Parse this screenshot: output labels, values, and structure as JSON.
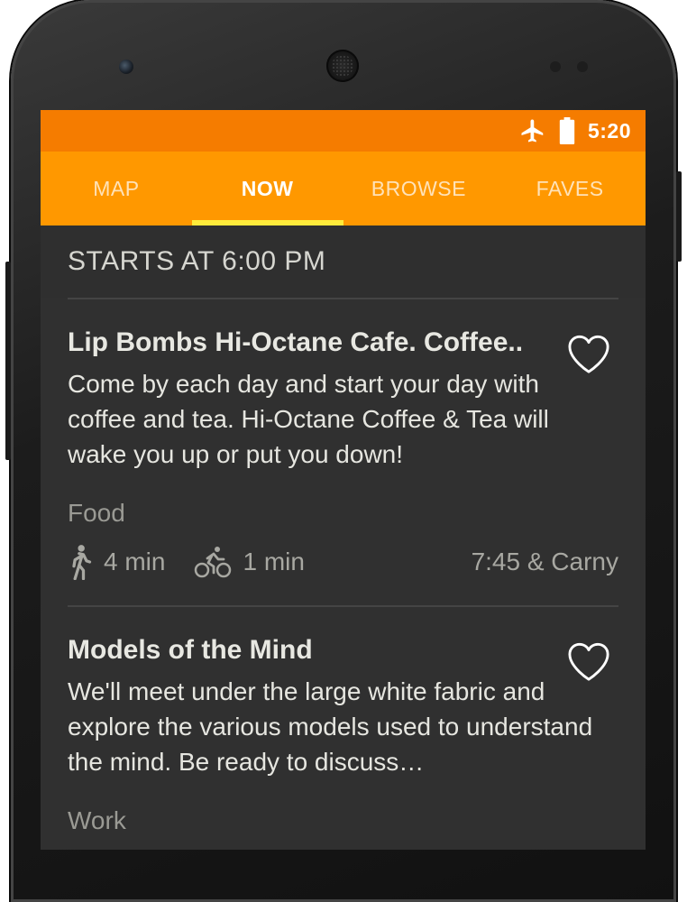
{
  "status_bar": {
    "airplane_icon": "airplane-icon",
    "battery_icon": "battery-icon",
    "time": "5:20",
    "color": "#f57c00"
  },
  "tabs": [
    {
      "label": "MAP",
      "active": false
    },
    {
      "label": "NOW",
      "active": true
    },
    {
      "label": "BROWSE",
      "active": false
    },
    {
      "label": "FAVES",
      "active": false
    }
  ],
  "tab_bar_color": "#ff9800",
  "tab_indicator_color": "#ffeb3b",
  "section": {
    "header": "STARTS AT 6:00 PM"
  },
  "events": [
    {
      "title": "Lip Bombs Hi-Octane Cafe. Coffee..",
      "description": "Come by each day and start your day with coffee and tea. Hi-Octane Coffee & Tea will wake you up or put you down!",
      "category": "Food",
      "walk_time": "4 min",
      "bike_time": "1 min",
      "location": "7:45 & Carny",
      "favorite": false
    },
    {
      "title": "Models of the Mind",
      "description": "We'll meet under the large white fabric and explore the various models used to understand the mind.  Be ready to discuss…",
      "category": "Work",
      "favorite": false
    }
  ]
}
